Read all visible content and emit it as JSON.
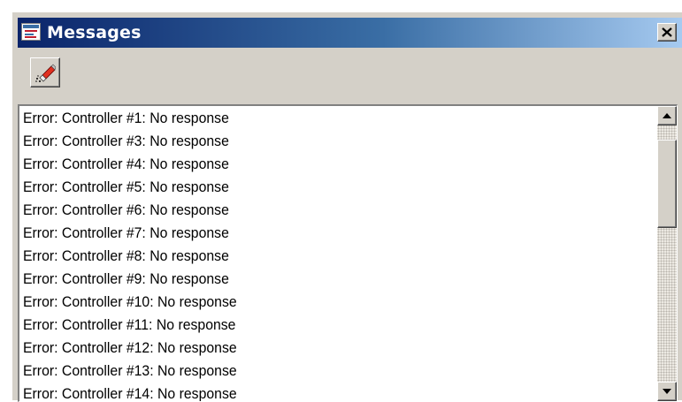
{
  "window": {
    "title": "Messages",
    "icon": "messages-window-icon",
    "close_icon": "close-icon"
  },
  "toolbar": {
    "clear_button_icon": "eraser-clear-icon"
  },
  "messages": [
    "Error: Controller #1: No response",
    "Error: Controller #3: No response",
    "Error: Controller #4: No response",
    "Error: Controller #5: No response",
    "Error: Controller #6: No response",
    "Error: Controller #7: No response",
    "Error: Controller #8: No response",
    "Error: Controller #9: No response",
    "Error: Controller #10: No response",
    "Error: Controller #11: No response",
    "Error: Controller #12: No response",
    "Error: Controller #13: No response",
    "Error: Controller #14: No response"
  ],
  "scrollbar": {
    "up_icon": "scroll-up-arrow-icon",
    "down_icon": "scroll-down-arrow-icon"
  },
  "colors": {
    "title_gradient_start": "#0a246a",
    "title_gradient_end": "#a6caf0",
    "face": "#d4d0c8",
    "list_background": "#ffffff",
    "text": "#000000"
  }
}
